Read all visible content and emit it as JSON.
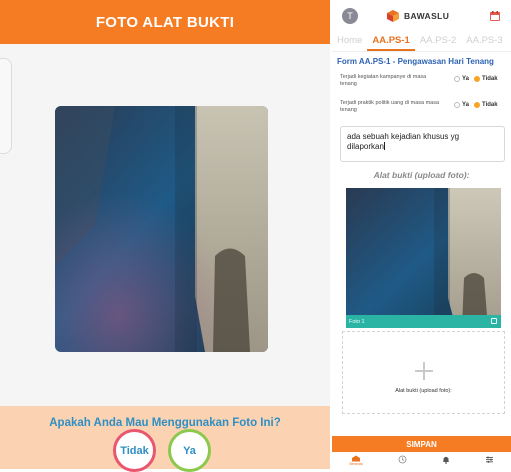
{
  "left_screen": {
    "header_title": "FOTO ALAT BUKTI",
    "question": "Apakah Anda Mau Menggunakan Foto Ini?",
    "no_button": "Tidak",
    "yes_button": "Ya"
  },
  "right_screen": {
    "avatar_initial": "T",
    "brand_name": "BAWASLU",
    "tabs": [
      {
        "label": "Home",
        "active": false
      },
      {
        "label": "AA.PS-1",
        "active": true
      },
      {
        "label": "AA.PS-2",
        "active": false
      },
      {
        "label": "AA.PS-3",
        "active": false
      }
    ],
    "form_title": "Form AA.PS-1 - Pengawasan Hari Tenang",
    "questions": [
      {
        "text": "Terjadi kegiatan kampanye di masa tenang",
        "yes": "Ya",
        "no": "Tidak",
        "selected": "Tidak"
      },
      {
        "text": "Terjadi praktik politik uang di masa masa tenang",
        "yes": "Ya",
        "no": "Tidak",
        "selected": "Tidak"
      }
    ],
    "description_text": "ada sebuah kejadian khusus yg dilaporkan",
    "upload_title": "Alat bukti (upload foto):",
    "photo_caption": "Foto 1",
    "upload_placeholder": "Alat bukti (upload foto):",
    "save_button": "SIMPAN",
    "bottom_nav": [
      {
        "icon": "home-icon",
        "label": "Beranda",
        "active": true
      },
      {
        "icon": "history-icon",
        "label": "",
        "active": false
      },
      {
        "icon": "bell-icon",
        "label": "",
        "active": false
      },
      {
        "icon": "settings-icon",
        "label": "",
        "active": false
      }
    ]
  },
  "colors": {
    "accent_orange": "#f57c23",
    "question_blue": "#2f8fc4",
    "form_title_blue": "#2d63b3",
    "teal_caption": "#2bb4a4",
    "no_ring": "#e9566f",
    "yes_ring": "#8cc84b"
  }
}
